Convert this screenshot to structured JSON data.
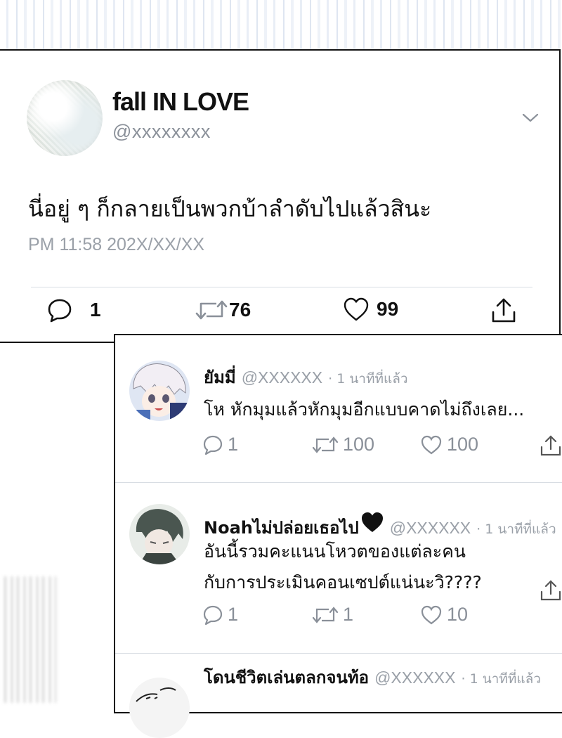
{
  "main_tweet": {
    "display_name": "fall IN LOVE",
    "handle": "@xxxxxxxx",
    "text": "นี่อยู่ ๆ ก็กลายเป็นพวกบ้าลำดับไปแล้วสินะ",
    "timestamp": "PM 11:58 202X/XX/XX",
    "replies": "1",
    "retweets": "76",
    "likes": "99"
  },
  "replies": [
    {
      "name": "ยัมมี่",
      "handle": "@XXXXXX",
      "time": "· 1 นาทีที่แล้ว",
      "lines": [
        "โห หักมุมแล้วหักมุมอีกแบบคาดไม่ถึงเลย..."
      ],
      "replies": "1",
      "retweets": "100",
      "likes": "100"
    },
    {
      "name": "Noahไม่ปล่อยเธอไป",
      "handle": "@XXXXXX",
      "time": "· 1 นาทีที่แล้ว",
      "lines": [
        "อันนี้รวมคะแนนโหวตของแต่ละคน",
        "กับการประเมินคอนเซปต์แน่นะวิ????"
      ],
      "replies": "1",
      "retweets": "1",
      "likes": "10"
    },
    {
      "name": "โดนชีวิตเล่นตลกจนท้อ",
      "handle": "@XXXXXX",
      "time": "· 1 นาทีที่แล้ว"
    }
  ],
  "icons": {
    "reply": "comment-bubble-icon",
    "retweet": "retweet-icon",
    "like": "heart-icon",
    "share": "share-icon",
    "more": "chevron-down-icon"
  },
  "colors": {
    "text": "#111111",
    "muted": "#8a9099",
    "border": "#111111",
    "divider": "#d8dde3"
  }
}
